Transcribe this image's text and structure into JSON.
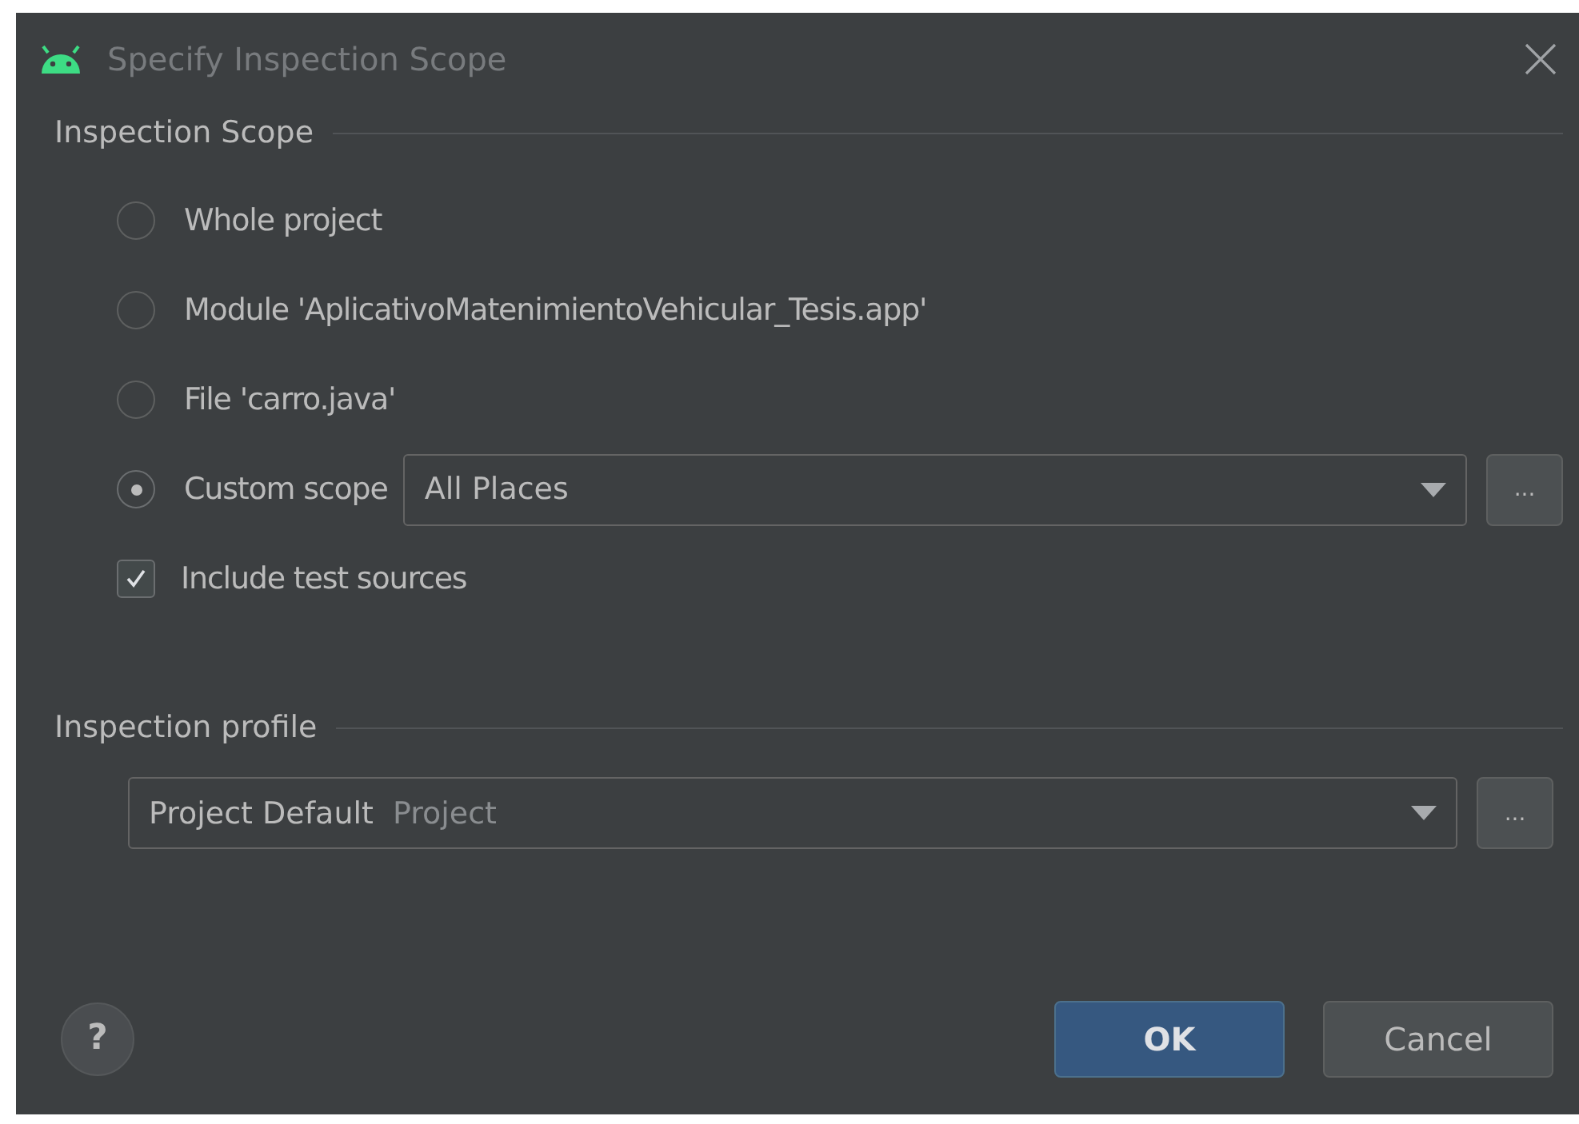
{
  "window": {
    "title": "Specify Inspection Scope"
  },
  "scope": {
    "title": "Inspection Scope",
    "options": [
      {
        "label": "Whole project",
        "selected": false
      },
      {
        "label": "Module 'AplicativoMatenimientoVehicular_Tesis.app'",
        "selected": false
      },
      {
        "label": "File 'carro.java'",
        "selected": false
      },
      {
        "label": "Custom scope",
        "selected": true,
        "dropdown": {
          "value": "All Places"
        },
        "more": "..."
      }
    ],
    "include_tests": {
      "label": "Include test sources",
      "checked": true
    }
  },
  "profile": {
    "title": "Inspection profile",
    "value": "Project Default",
    "hint": "Project",
    "more": "..."
  },
  "help": "?",
  "buttons": [
    {
      "label": "OK",
      "kind": "primary"
    },
    {
      "label": "Cancel",
      "kind": "secondary"
    }
  ]
}
